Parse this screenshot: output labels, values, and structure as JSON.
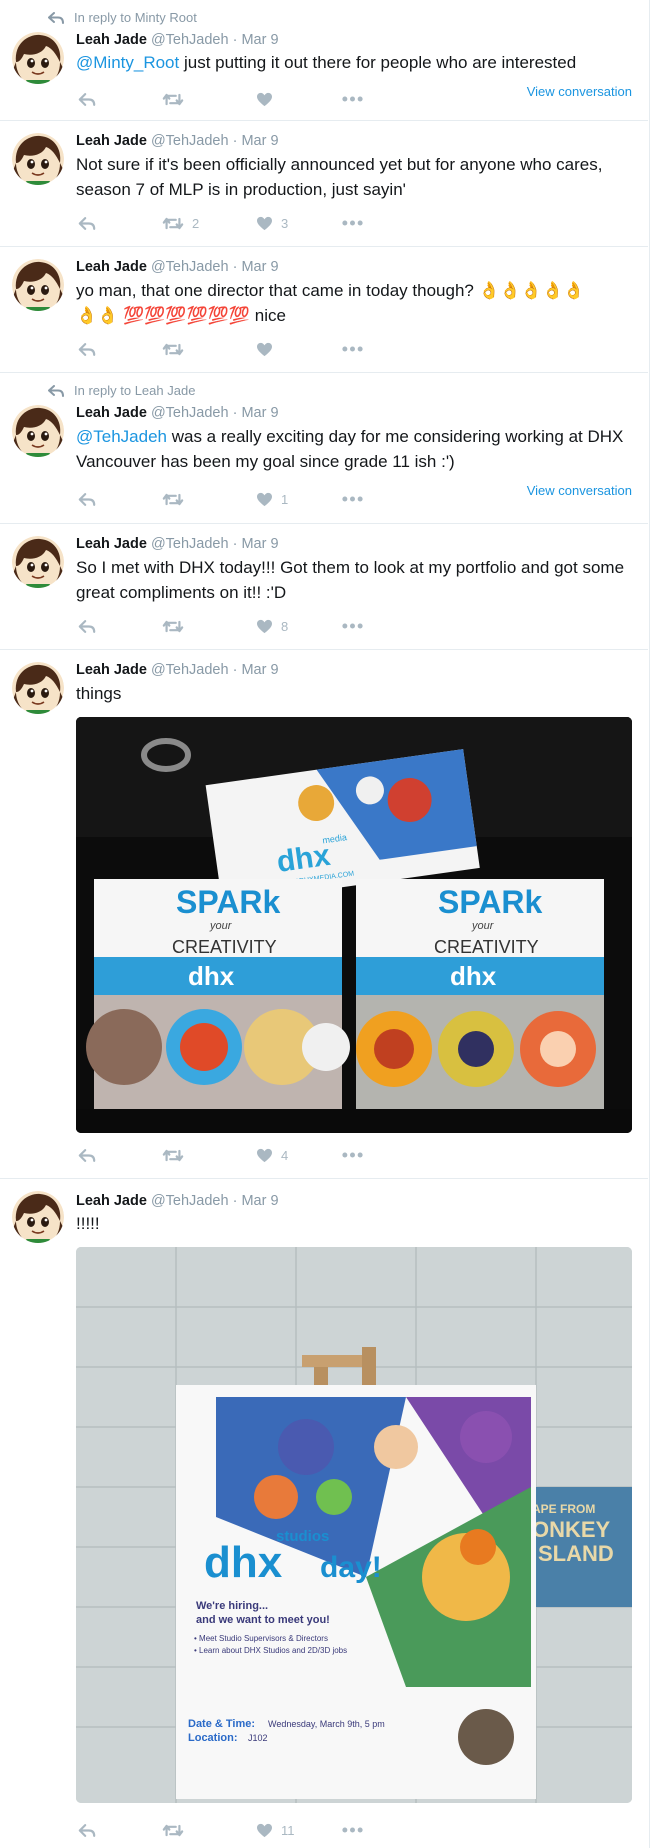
{
  "tweets": [
    {
      "reply_context": "In reply to Minty Root",
      "name": "Leah Jade",
      "handle": "@TehJadeh",
      "date": "Mar 9",
      "mention": "@Minty_Root",
      "text": " just putting it out there for people who are interested",
      "view_conversation": "View conversation",
      "retweets": "",
      "likes": ""
    },
    {
      "name": "Leah Jade",
      "handle": "@TehJadeh",
      "date": "Mar 9",
      "text": "Not sure if it's been officially announced yet but for anyone who cares, season 7 of MLP is in production, just sayin'",
      "retweets": "2",
      "likes": "3"
    },
    {
      "name": "Leah Jade",
      "handle": "@TehJadeh",
      "date": "Mar 9",
      "text_line1": "yo man, that one director that came in today though? 👌👌👌👌👌",
      "text_line2": "👌👌 💯💯💯💯💯💯 nice",
      "retweets": "",
      "likes": ""
    },
    {
      "reply_context": "In reply to Leah Jade",
      "name": "Leah Jade",
      "handle": "@TehJadeh",
      "date": "Mar 9",
      "mention": "@TehJadeh",
      "text": " was a really exciting day for me considering working at DHX Vancouver has been my goal since grade 11 ish :')",
      "view_conversation": "View conversation",
      "retweets": "",
      "likes": "1"
    },
    {
      "name": "Leah Jade",
      "handle": "@TehJadeh",
      "date": "Mar 9",
      "text": "So I met with DHX today!!! Got them to look at my portfolio and got some great compliments on it!! :'D",
      "retweets": "",
      "likes": "8"
    },
    {
      "name": "Leah Jade",
      "handle": "@TehJadeh",
      "date": "Mar 9",
      "text": "things",
      "retweets": "",
      "likes": "4",
      "photo": {
        "card_brand": "dhx",
        "card_brand_small": "media",
        "card_url": "WWW.DHXMEDIA.COM",
        "pack_title": "SPARk",
        "pack_your": "your",
        "pack_creativity": "CREATIVITY",
        "pack_brand": "dhx"
      }
    },
    {
      "name": "Leah Jade",
      "handle": "@TehJadeh",
      "date": "Mar 9",
      "text": "!!!!!",
      "retweets": "",
      "likes": "11",
      "photo": {
        "studios": "studios",
        "brand": "dhx",
        "day": "day!",
        "hiring": "We're hiring...",
        "want": "and we want to meet you!",
        "bullet1": "• Meet Studio Supervisors & Directors",
        "bullet2": "• Learn about DHX Studios and 2D/3D jobs",
        "date_label": "Date & Time:",
        "date_value": "Wednesday, March 9th, 5 pm",
        "loc_label": "Location:",
        "loc_value": "J102",
        "sign_line1": "APE FROM",
        "sign_line2": "ONKEY",
        "sign_line3": "SLAND"
      }
    }
  ],
  "colors": {
    "link": "#1b95e0",
    "muted": "#8899a6",
    "action": "#aab8c2",
    "border": "#e6ecf0"
  },
  "icons": [
    "reply-arrow-icon",
    "reply-icon",
    "retweet-icon",
    "heart-icon",
    "more-icon"
  ]
}
